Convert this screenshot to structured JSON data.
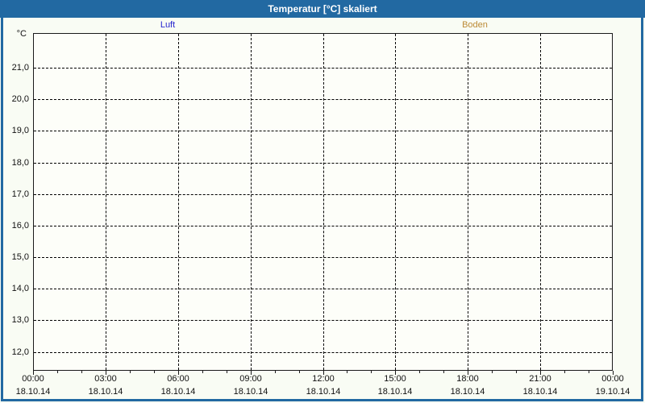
{
  "window": {
    "title": "Temperatur [°C] skaliert"
  },
  "theme": {
    "titlebar_color": "#2269A2",
    "titlebar_text_color": "#FFFFFF",
    "border_color": "#2269A2",
    "outer_background": "#F9FCF4",
    "plot_background": "#FDFEF9",
    "grid_color": "#000000",
    "axis_text_color": "#111111"
  },
  "legend": {
    "items": [
      {
        "label": "Luft",
        "color": "#2525CE"
      },
      {
        "label": "Boden",
        "color": "#BC8A35"
      }
    ]
  },
  "chart_data": {
    "type": "line",
    "title": "Temperatur [°C] skaliert",
    "xlabel": "",
    "ylabel": "°C",
    "ylim": [
      11.4,
      22.1
    ],
    "grid": true,
    "legend_position": "top",
    "y_ticks": [
      {
        "value": 21.0,
        "label": "21,0"
      },
      {
        "value": 20.0,
        "label": "20,0"
      },
      {
        "value": 19.0,
        "label": "19,0"
      },
      {
        "value": 18.0,
        "label": "18,0"
      },
      {
        "value": 17.0,
        "label": "17,0"
      },
      {
        "value": 16.0,
        "label": "16,0"
      },
      {
        "value": 15.0,
        "label": "15,0"
      },
      {
        "value": 14.0,
        "label": "14,0"
      },
      {
        "value": 13.0,
        "label": "13,0"
      },
      {
        "value": 12.0,
        "label": "12,0"
      }
    ],
    "x_ticks": [
      {
        "time": "00:00",
        "date": "18.10.14"
      },
      {
        "time": "03:00",
        "date": "18.10.14"
      },
      {
        "time": "06:00",
        "date": "18.10.14"
      },
      {
        "time": "09:00",
        "date": "18.10.14"
      },
      {
        "time": "12:00",
        "date": "18.10.14"
      },
      {
        "time": "15:00",
        "date": "18.10.14"
      },
      {
        "time": "18:00",
        "date": "18.10.14"
      },
      {
        "time": "21:00",
        "date": "18.10.14"
      },
      {
        "time": "00:00",
        "date": "19.10.14"
      }
    ],
    "minor_ticks_between_major": 2,
    "series": [
      {
        "name": "Luft",
        "color": "#2525CE",
        "points": []
      },
      {
        "name": "Boden",
        "color": "#BC8A35",
        "points": []
      }
    ]
  }
}
